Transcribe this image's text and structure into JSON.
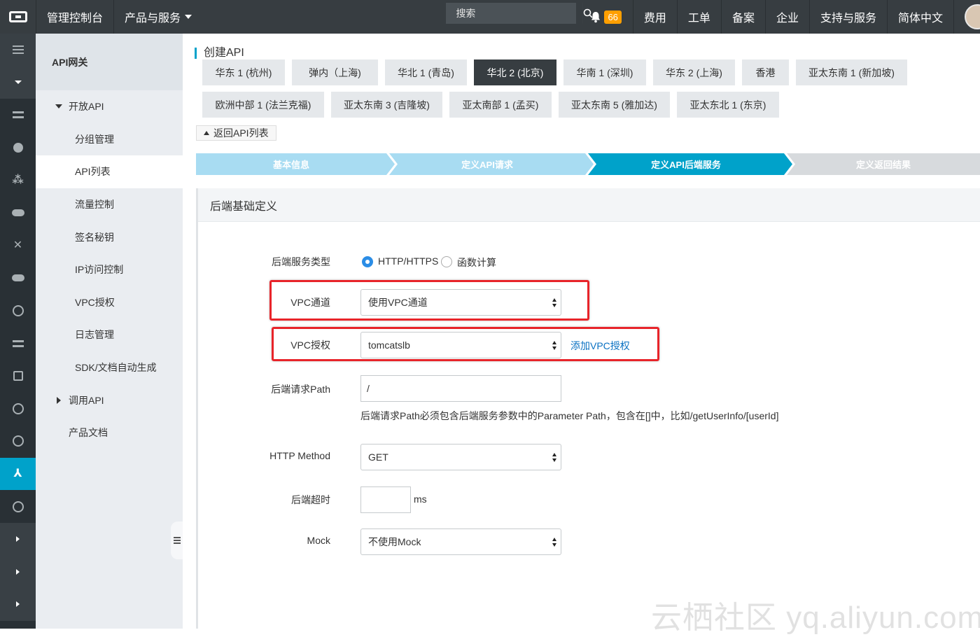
{
  "topbar": {
    "console": "管理控制台",
    "products": "产品与服务",
    "search_placeholder": "搜索",
    "notifications": "66",
    "links": [
      "费用",
      "工单",
      "备案",
      "企业",
      "支持与服务",
      "简体中文"
    ]
  },
  "sidebar": {
    "title": "API网关",
    "open_api": "开放API",
    "items": [
      "分组管理",
      "API列表",
      "流量控制",
      "签名秘钥",
      "IP访问控制",
      "VPC授权",
      "日志管理",
      "SDK/文档自动生成"
    ],
    "call_api": "调用API",
    "product_docs": "产品文档"
  },
  "main": {
    "page_title": "创建API",
    "regions": [
      "华东 1 (杭州)",
      "弹内（上海)",
      "华北 1 (青岛)",
      "华北 2 (北京)",
      "华南 1 (深圳)",
      "华东 2 (上海)",
      "香港",
      "亚太东南 1 (新加坡)",
      "欧洲中部 1 (法兰克福)",
      "亚太东南 3 (吉隆坡)",
      "亚太南部 1 (孟买)",
      "亚太东南 5 (雅加达)",
      "亚太东北 1 (东京)"
    ],
    "active_region": "华北 2 (北京)",
    "back": "返回API列表",
    "steps": [
      "基本信息",
      "定义API请求",
      "定义API后端服务",
      "定义返回结果"
    ],
    "panel_title": "后端基础定义",
    "form": {
      "backend_type_label": "后端服务类型",
      "backend_type_http": "HTTP/HTTPS",
      "backend_type_fc": "函数计算",
      "vpc_channel_label": "VPC通道",
      "vpc_channel_value": "使用VPC通道",
      "vpc_auth_label": "VPC授权",
      "vpc_auth_value": "tomcatslb",
      "add_vpc_auth": "添加VPC授权",
      "path_label": "后端请求Path",
      "path_value": "/",
      "path_hint": "后端请求Path必须包含后端服务参数中的Parameter Path，包含在[]中，比如/getUserInfo/[userId]",
      "method_label": "HTTP Method",
      "method_value": "GET",
      "timeout_label": "后端超时",
      "timeout_value": "",
      "timeout_unit": "ms",
      "mock_label": "Mock",
      "mock_value": "不使用Mock"
    }
  },
  "watermark": "云栖社区 yq.aliyun.com",
  "colors": {
    "accent": "#00a2ca",
    "topbar": "#373d41",
    "rail": "#293035",
    "highlight": "#e8242a",
    "step_done": "#a8dcf2",
    "step_active": "#00a2ca",
    "step_todo": "#d7dadd"
  }
}
